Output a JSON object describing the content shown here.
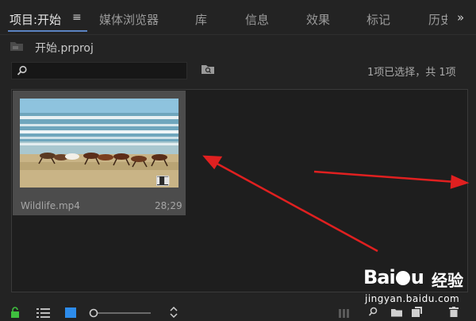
{
  "tabs": [
    {
      "label": "项目:开始",
      "active": true
    },
    {
      "label": "媒体浏览器"
    },
    {
      "label": "库"
    },
    {
      "label": "信息"
    },
    {
      "label": "效果"
    },
    {
      "label": "标记"
    },
    {
      "label": "历史"
    }
  ],
  "project": {
    "name": "开始.prproj"
  },
  "search": {
    "value": "",
    "placeholder": ""
  },
  "selection_status": "1项已选择，共 1项",
  "clip": {
    "name": "Wildlife.mp4",
    "duration": "28;29",
    "has_audio": true
  },
  "watermark": {
    "brand": "Baidu",
    "cn": "经验",
    "url": "jingyan.baidu.com"
  },
  "colors": {
    "panel_bg": "#232323",
    "content_bg": "#1e1e1e",
    "tab_underline": "#5b83c2",
    "annotation_arrow": "#e02020",
    "lock_icon": "#3fbf3f",
    "icon_view_active": "#2d8ceb"
  },
  "icons": [
    "menu-icon",
    "overflow-icon",
    "folder-icon",
    "search-icon",
    "new-bin-icon",
    "lock-icon",
    "list-view-icon",
    "icon-view-icon",
    "zoom-slider",
    "sort-icon",
    "freeform-view-icon",
    "find-icon",
    "new-bin-icon",
    "new-item-icon",
    "trash-icon"
  ]
}
